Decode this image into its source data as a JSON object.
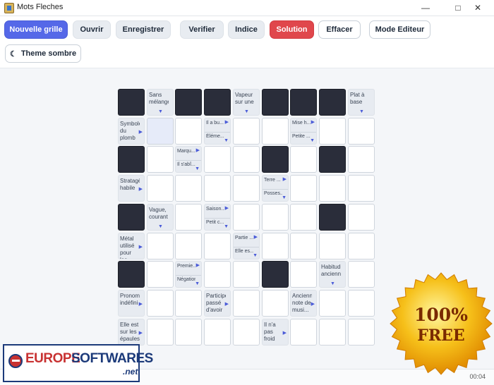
{
  "window": {
    "title": "Mots Fleches"
  },
  "toolbar": {
    "new_grid": "Nouvelle grille",
    "open": "Ouvrir",
    "save": "Enregistrer",
    "verify": "Verifier",
    "hint": "Indice",
    "solution": "Solution",
    "clear": "Effacer",
    "editor_mode": "Mode Editeur",
    "dark_theme": "Theme sombre"
  },
  "colors": {
    "primary": "#5568e8",
    "solution": "#e0474c",
    "black_cell": "#2a2d3a",
    "selected_cell": "#e6ebf9"
  },
  "grid": {
    "rows": 9,
    "cols": 9,
    "cells": [
      [
        "B",
        {
          "def": "Sans\nmélange",
          "arrow": "down"
        },
        "B",
        "B",
        {
          "def": "Vapeur\nsur une",
          "arrow": "down"
        },
        "B",
        "B",
        "B",
        {
          "def": "Plat à\nbase",
          "arrow": "down"
        }
      ],
      [
        {
          "def": "Symbole\ndu\nplomb",
          "arrow": "right"
        },
        "S",
        "E",
        {
          "top": "Il a bu...",
          "bot": "Éléme..."
        },
        "E",
        "E",
        {
          "top": "Mise h...",
          "bot": "Petite ..."
        },
        "E",
        "E"
      ],
      [
        "B",
        "E",
        {
          "top": "Marqu...",
          "bot": "Il s'abî..."
        },
        "E",
        "E",
        "B",
        "E",
        "B",
        "E"
      ],
      [
        {
          "def": "Stratagème\nhabile",
          "arrow": "right"
        },
        "E",
        "E",
        "E",
        "E",
        {
          "top": "Terre ...",
          "bot": "Posses..."
        },
        "E",
        "E",
        "E"
      ],
      [
        "B",
        {
          "def": "Vague,\ncourant",
          "arrow": "down"
        },
        "E",
        {
          "top": "Saison...",
          "bot": "Petit c..."
        },
        "E",
        "E",
        "E",
        "B",
        "E"
      ],
      [
        {
          "def": "Métal\nutilisé\npour les",
          "arrow": "right"
        },
        "E",
        "E",
        "E",
        {
          "top": "Partie ...",
          "bot": "Elle es..."
        },
        "E",
        "E",
        "E",
        "E"
      ],
      [
        "B",
        "E",
        {
          "top": "Premie...",
          "bot": "Négation"
        },
        "E",
        "E",
        "B",
        "E",
        {
          "def": "Habitudes\nanciennes",
          "arrow": "down"
        },
        "E"
      ],
      [
        {
          "def": "Pronom\nindéfini",
          "arrow": "right"
        },
        "E",
        "E",
        {
          "def": "Participe\npassé\nd'avoir",
          "arrow": "right"
        },
        "E",
        "E",
        {
          "def": "Ancienne\nnote de\nmusi...",
          "arrow": "right"
        },
        "E",
        "E"
      ],
      [
        {
          "def": "Elle est\nsur les\népaules",
          "arrow": "right"
        },
        "E",
        "E",
        "E",
        "E",
        {
          "def": "Il n'a\npas\nfroid",
          "arrow": "right"
        },
        "E",
        "E",
        "E"
      ]
    ]
  },
  "status": {
    "timer": "00:04"
  },
  "watermark": {
    "brand_red": "EUROPE",
    "brand_blue": "SOFTWARES",
    "suffix": ".net",
    "seal_line1": "100%",
    "seal_line2": "FREE"
  }
}
